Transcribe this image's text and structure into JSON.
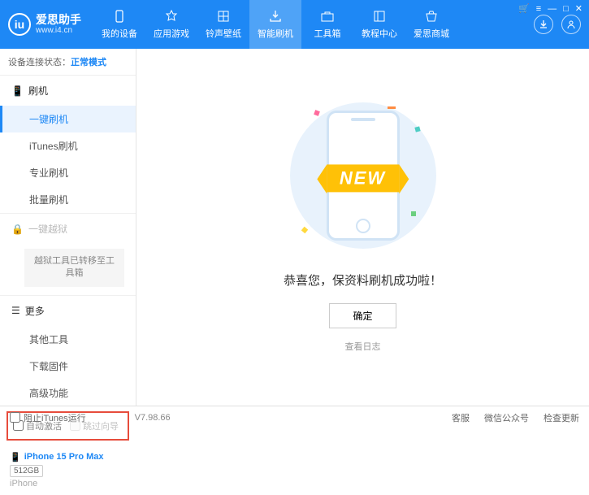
{
  "app": {
    "name": "爱思助手",
    "url": "www.i4.cn"
  },
  "nav": [
    {
      "label": "我的设备"
    },
    {
      "label": "应用游戏"
    },
    {
      "label": "铃声壁纸"
    },
    {
      "label": "智能刷机",
      "active": true
    },
    {
      "label": "工具箱"
    },
    {
      "label": "教程中心"
    },
    {
      "label": "爱思商城"
    }
  ],
  "status": {
    "label": "设备连接状态：",
    "mode": "正常模式"
  },
  "sidebar": {
    "flash": {
      "title": "刷机",
      "items": [
        "一键刷机",
        "iTunes刷机",
        "专业刷机",
        "批量刷机"
      ],
      "activeIndex": 0
    },
    "jailbreak": {
      "title": "一键越狱",
      "note": "越狱工具已转移至工具箱"
    },
    "more": {
      "title": "更多",
      "items": [
        "其他工具",
        "下载固件",
        "高级功能"
      ]
    }
  },
  "activation": {
    "auto": "自动激活",
    "skip": "跳过向导"
  },
  "device": {
    "name": "iPhone 15 Pro Max",
    "storage": "512GB",
    "type": "iPhone"
  },
  "main": {
    "banner": "NEW",
    "message": "恭喜您，保资料刷机成功啦！",
    "ok": "确定",
    "log": "查看日志"
  },
  "footer": {
    "block": "阻止iTunes运行",
    "version": "V7.98.66",
    "links": [
      "客服",
      "微信公众号",
      "检查更新"
    ]
  }
}
